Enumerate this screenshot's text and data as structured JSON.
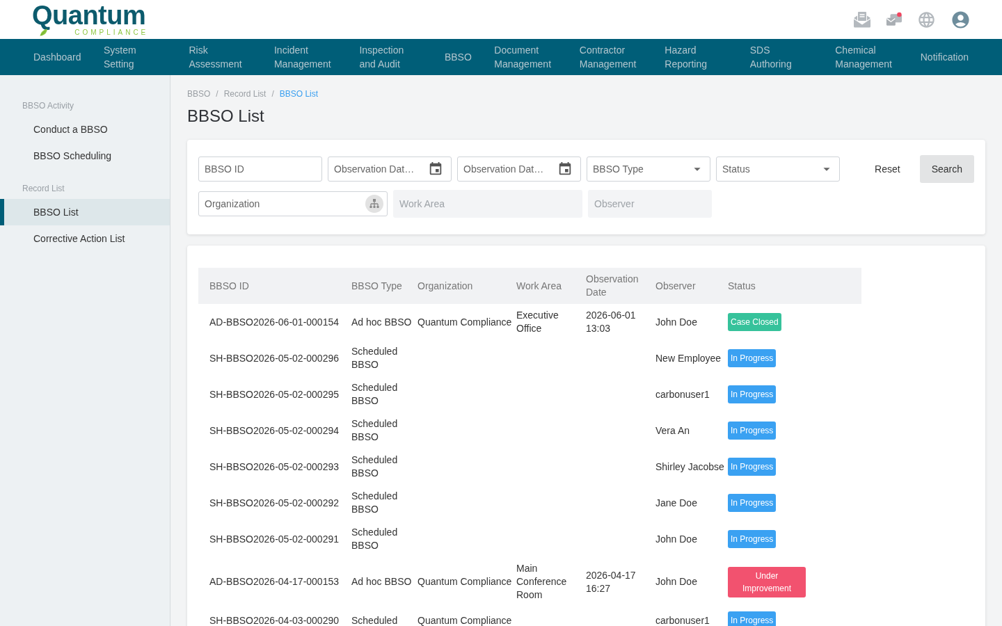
{
  "header": {
    "logo": {
      "name": "Quantum",
      "tagline": "COMPLIANCE"
    }
  },
  "nav": {
    "items": [
      "Dashboard",
      "System Setting",
      "Risk Assessment",
      "Incident Management",
      "Inspection and Audit",
      "BBSO",
      "Document Management",
      "Contractor Management",
      "Hazard Reporting",
      "SDS Authoring",
      "Chemical Management",
      "Notification"
    ]
  },
  "sidebar": {
    "groups": [
      {
        "title": "BBSO Activity",
        "items": [
          {
            "label": "Conduct a BBSO",
            "selected": false
          },
          {
            "label": "BBSO Scheduling",
            "selected": false
          }
        ]
      },
      {
        "title": "Record List",
        "items": [
          {
            "label": "BBSO List",
            "selected": true
          },
          {
            "label": "Corrective Action List",
            "selected": false
          }
        ]
      }
    ]
  },
  "breadcrumb": {
    "separator": "/",
    "items": [
      {
        "label": "BBSO",
        "current": false
      },
      {
        "label": "Record List",
        "current": false
      },
      {
        "label": "BBSO List",
        "current": true
      }
    ]
  },
  "title": "BBSO List",
  "filters": {
    "fields": [
      {
        "kind": "text",
        "placeholder": "BBSO ID",
        "disabled": false
      },
      {
        "kind": "date",
        "placeholder": "Observation Dat…",
        "disabled": false
      },
      {
        "kind": "date",
        "placeholder": "Observation Dat…",
        "disabled": false
      },
      {
        "kind": "select",
        "placeholder": "BBSO Type",
        "disabled": false
      },
      {
        "kind": "select",
        "placeholder": "Status",
        "disabled": false
      },
      {
        "kind": "tree",
        "placeholder": "Organization",
        "disabled": false
      },
      {
        "kind": "text",
        "placeholder": "Work Area",
        "disabled": true
      },
      {
        "kind": "text",
        "placeholder": "Observer",
        "disabled": true
      }
    ],
    "buttons": [
      {
        "kind": "text",
        "label": "Reset"
      },
      {
        "kind": "filled",
        "label": "Search"
      }
    ]
  },
  "table": {
    "columns": [
      "BBSO ID",
      "BBSO Type",
      "Organization",
      "Work Area",
      "Observation Date",
      "Observer",
      "Status"
    ],
    "rows": [
      {
        "bbso_id": "AD-BBSO2026-06-01-000154",
        "bbso_type": "Ad hoc BBSO",
        "organization": "Quantum Compliance",
        "work_area": "Executive Office",
        "observation_date": "2026-06-01 13:03",
        "observer": "John Doe",
        "status": {
          "label": "Case Closed",
          "color": "#36c29b"
        }
      },
      {
        "bbso_id": "SH-BBSO2026-05-02-000296",
        "bbso_type": "Scheduled BBSO",
        "observer": "New Employee",
        "status": {
          "label": "In Progress",
          "color": "#3aa1f2"
        }
      },
      {
        "bbso_id": "SH-BBSO2026-05-02-000295",
        "bbso_type": "Scheduled BBSO",
        "observer": "carbonuser1",
        "status": {
          "label": "In Progress",
          "color": "#3aa1f2"
        }
      },
      {
        "bbso_id": "SH-BBSO2026-05-02-000294",
        "bbso_type": "Scheduled BBSO",
        "observer": "Vera An",
        "status": {
          "label": "In Progress",
          "color": "#3aa1f2"
        }
      },
      {
        "bbso_id": "SH-BBSO2026-05-02-000293",
        "bbso_type": "Scheduled BBSO",
        "observer": "Shirley Jacobse",
        "status": {
          "label": "In Progress",
          "color": "#3aa1f2"
        }
      },
      {
        "bbso_id": "SH-BBSO2026-05-02-000292",
        "bbso_type": "Scheduled BBSO",
        "observer": "Jane Doe",
        "status": {
          "label": "In Progress",
          "color": "#3aa1f2"
        }
      },
      {
        "bbso_id": "SH-BBSO2026-05-02-000291",
        "bbso_type": "Scheduled BBSO",
        "observer": "John Doe",
        "status": {
          "label": "In Progress",
          "color": "#3aa1f2"
        }
      },
      {
        "bbso_id": "AD-BBSO2026-04-17-000153",
        "bbso_type": "Ad hoc BBSO",
        "organization": "Quantum Compliance",
        "work_area": "Main Conference Room",
        "observation_date": "2026-04-17 16:27",
        "observer": "John Doe",
        "status": {
          "label": "Under Improvement",
          "color": "#f2526f"
        }
      },
      {
        "bbso_id": "SH-BBSO2026-04-03-000290",
        "bbso_type": "Scheduled",
        "organization": "Quantum Compliance",
        "observer": "carbonuser1",
        "status": {
          "label": "In Progress",
          "color": "#3aa1f2"
        }
      }
    ]
  }
}
